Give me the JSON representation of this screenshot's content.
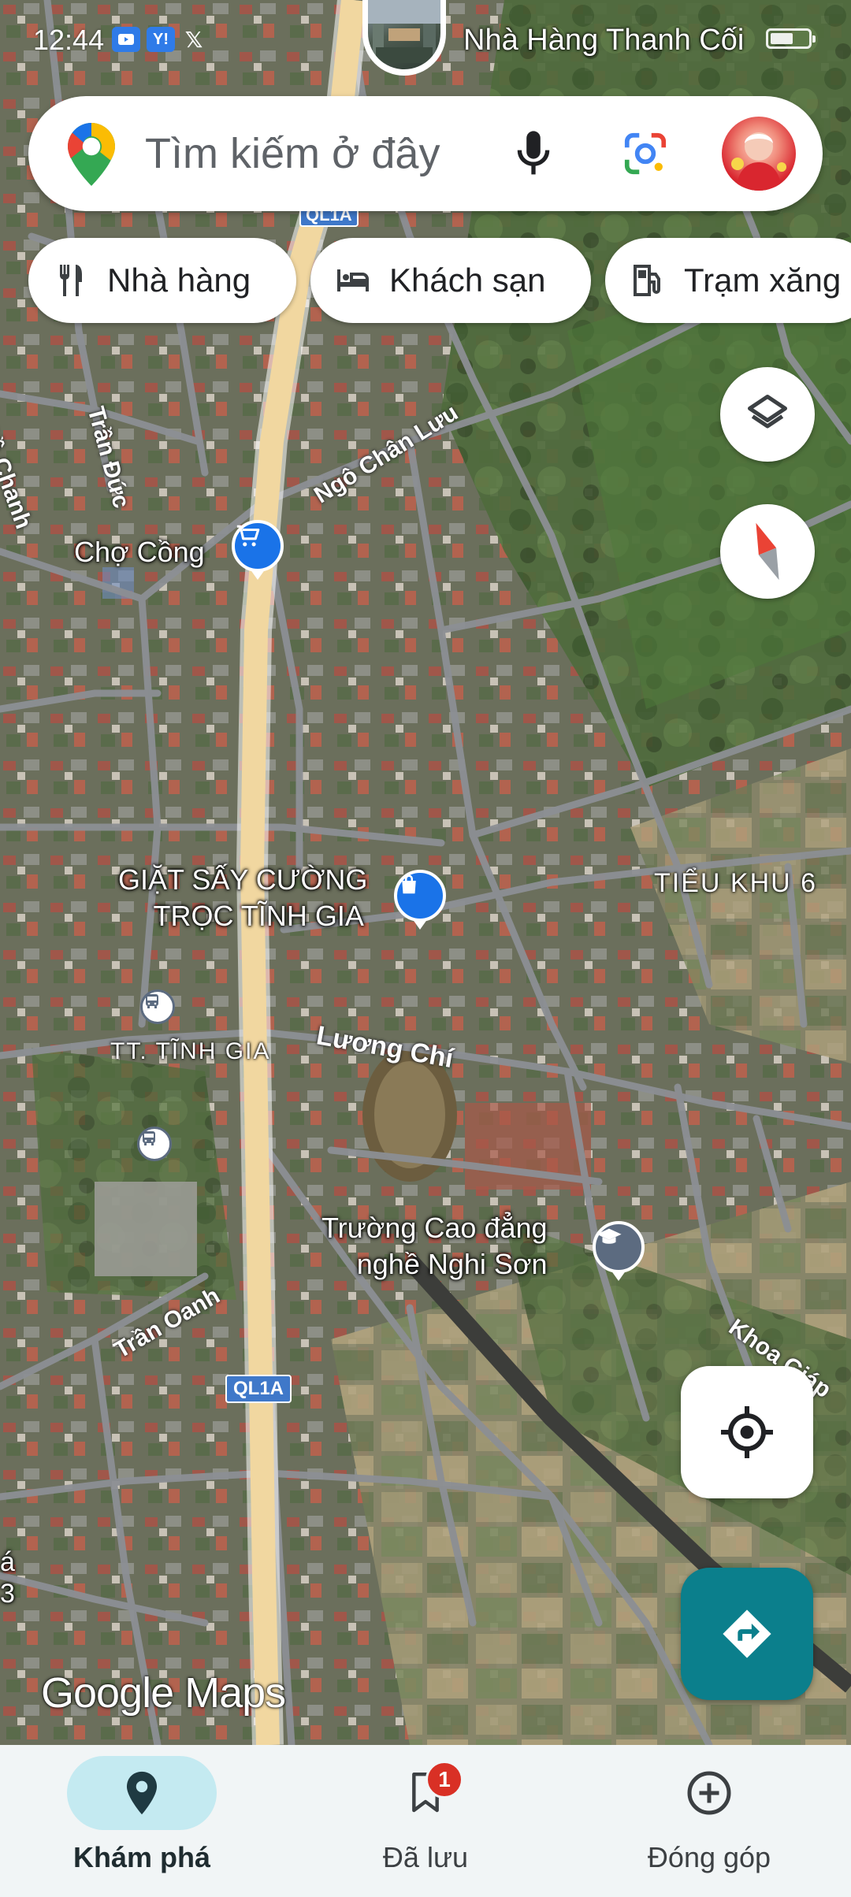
{
  "status_bar": {
    "time": "12:44",
    "notifications": [
      "video-app-icon",
      "yahoo-icon",
      "x-icon"
    ],
    "yahoo_label": "Y!",
    "x_label": "𝕏",
    "place_name": "Nhà Hàng Thanh Cối"
  },
  "search": {
    "placeholder": "Tìm kiếm ở đây"
  },
  "chips": [
    {
      "label": "Nhà hàng",
      "icon": "fork-knife-icon"
    },
    {
      "label": "Khách sạn",
      "icon": "bed-icon"
    },
    {
      "label": "Trạm xăng",
      "icon": "gas-pump-icon"
    }
  ],
  "map": {
    "places": [
      {
        "name": "Chợ Cồng",
        "type": "shopping-cart"
      },
      {
        "name": "GIẶT SẤY CƯỜNG TRỌC TĨNH GIA",
        "line1": "GIẶT SẤY CƯỜNG",
        "line2": "TRỌC TĨNH GIA",
        "type": "shopping-bag"
      },
      {
        "name": "Trường Cao đẳng nghề Nghi Sơn",
        "line1": "Trường Cao đẳng",
        "line2": "nghề Nghi Sơn",
        "type": "school"
      }
    ],
    "roads": {
      "tran_duc": "Trần Đức",
      "do_chanh": "Đồ Chanh",
      "ngo_chan_luu": "Ngô Chân Lưu",
      "luong_chi": "Lương Chí",
      "tran_oanh": "Trần Oanh",
      "khoa_giap": "Khoa Giáp"
    },
    "areas": {
      "tieu_khu": "TIỂU KHU 6",
      "tt_tinh_gia": "TT. TĨNH GIA"
    },
    "highway_shield": "QL1A",
    "edge_label_a": "á",
    "edge_label_b": "3"
  },
  "logo": "Google Maps",
  "bottom_nav": {
    "items": [
      {
        "label": "Khám phá",
        "icon": "location-pin-icon",
        "active": true
      },
      {
        "label": "Đã lưu",
        "icon": "bookmark-icon",
        "badge": "1"
      },
      {
        "label": "Đóng góp",
        "icon": "add-circle-icon"
      }
    ]
  },
  "colors": {
    "accent": "#0b7f8c",
    "active_nav_bg": "#c4eaf1",
    "badge": "#d93025",
    "pin_blue": "#1a73e8",
    "highway": "#f1d7a0"
  }
}
